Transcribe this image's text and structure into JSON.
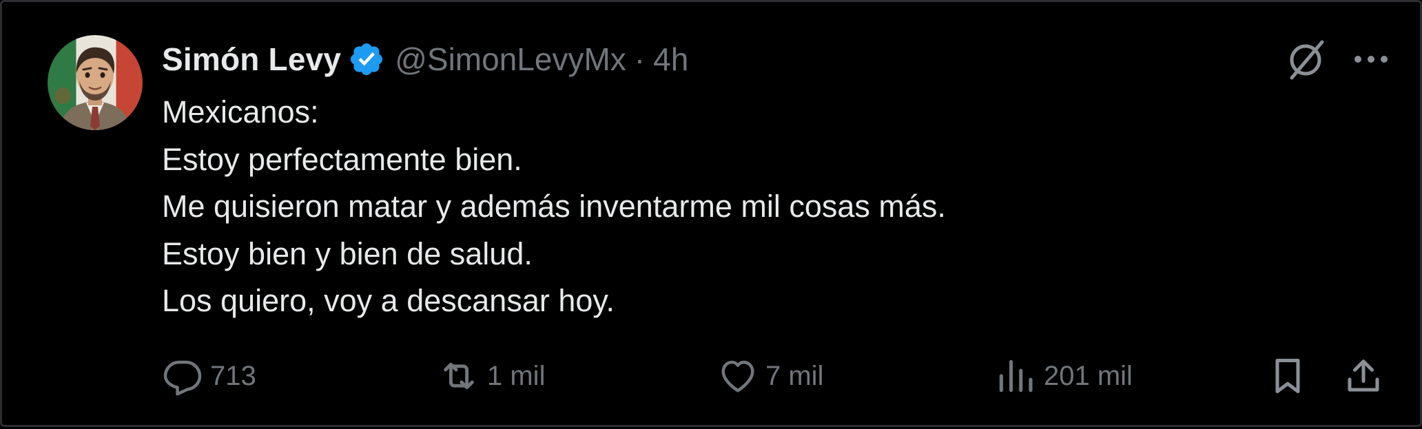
{
  "tweet": {
    "author": {
      "name": "Simón Levy",
      "handle": "@SimonLevyMx",
      "verified": true,
      "avatar": "cartoon-man-portrait-with-mexican-flag"
    },
    "separator": "·",
    "time": "4h",
    "lines": [
      "Mexicanos:",
      "Estoy perfectamente bien.",
      "Me quisieron matar y además inventarme mil cosas más.",
      "Estoy bien y bien de salud.",
      "Los quiero, voy a descansar hoy."
    ],
    "stats": {
      "replies": "713",
      "reposts": "1 mil",
      "likes": "7 mil",
      "views": "201 mil"
    }
  },
  "icons": {
    "verified": "verified-badge-icon",
    "grok": "grok-icon",
    "more": "more-icon",
    "reply": "reply-icon",
    "repost": "repost-icon",
    "like": "like-icon",
    "views": "views-icon",
    "bookmark": "bookmark-icon",
    "share": "share-icon"
  },
  "colors": {
    "background": "#000000",
    "text": "#e7e9ea",
    "secondary": "#71767b",
    "verified": "#1d9bf0"
  }
}
